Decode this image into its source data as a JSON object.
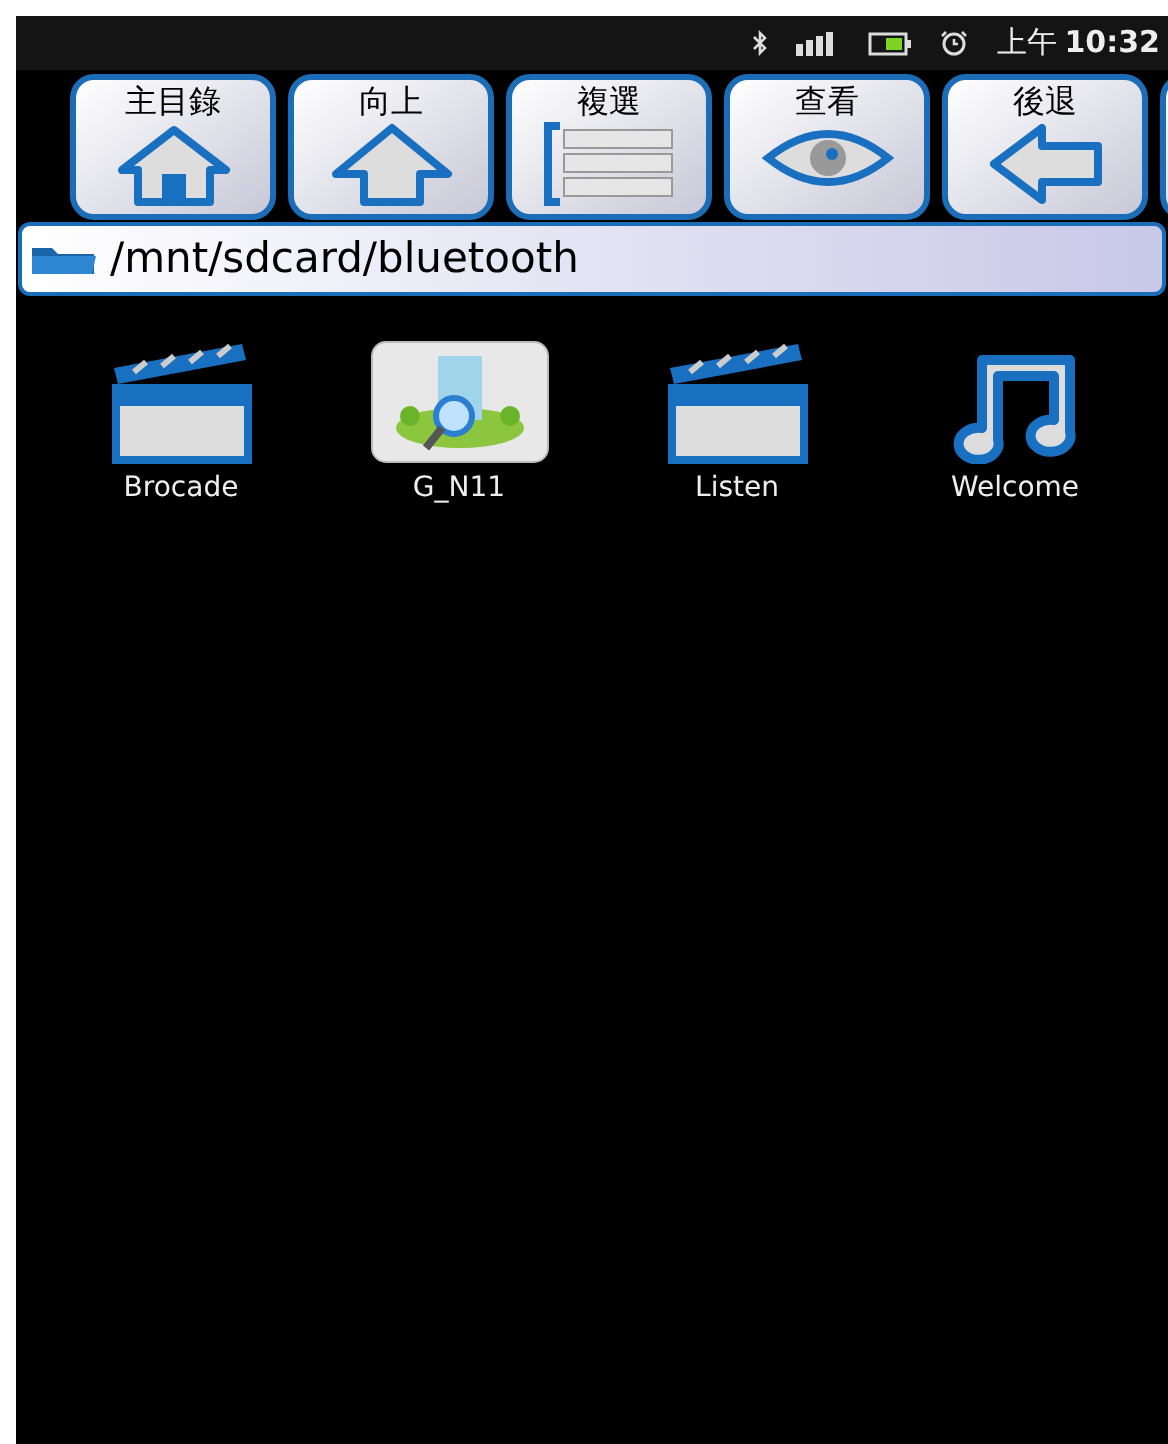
{
  "status_bar": {
    "time_prefix": "上午",
    "time": "10:32"
  },
  "toolbar": [
    {
      "label": "主目錄",
      "kind": "home"
    },
    {
      "label": "向上",
      "kind": "up"
    },
    {
      "label": "複選",
      "kind": "multiselect"
    },
    {
      "label": "查看",
      "kind": "view"
    },
    {
      "label": "後退",
      "kind": "back"
    }
  ],
  "path": "/mnt/sdcard/bluetooth",
  "files": [
    {
      "name": "Brocade",
      "kind": "video"
    },
    {
      "name": "G_N11",
      "kind": "app"
    },
    {
      "name": "Listen",
      "kind": "video"
    },
    {
      "name": "Welcome",
      "kind": "audio"
    }
  ]
}
